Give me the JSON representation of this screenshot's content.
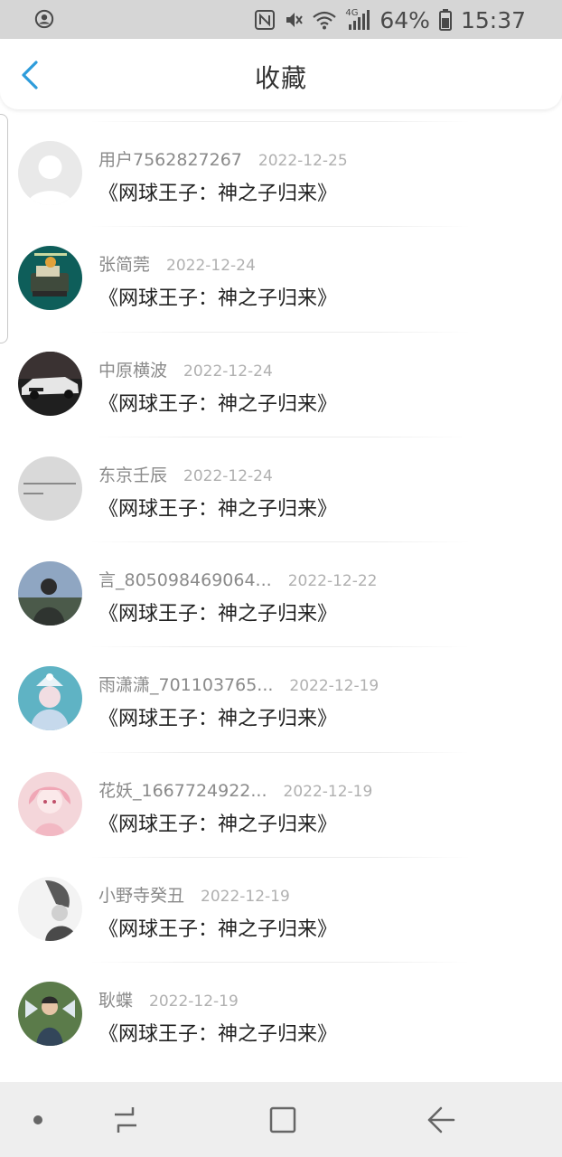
{
  "status_bar": {
    "battery": "64%",
    "time": "15:37",
    "network": "4G",
    "icons": [
      "account-circle-icon",
      "nfc-icon",
      "mute-icon",
      "wifi-icon",
      "signal-icon",
      "battery-icon"
    ]
  },
  "header": {
    "title": "收藏",
    "back_icon": "chevron-left-icon",
    "accent": "#2d9cdb"
  },
  "favorites": [
    {
      "name": "用户7562827267",
      "date": "2022-12-25",
      "work": "《网球王子：神之子归来》",
      "avatar": "default-gray"
    },
    {
      "name": "张简莞",
      "date": "2022-12-24",
      "work": "《网球王子：神之子归来》",
      "avatar": "teal-cartoon"
    },
    {
      "name": "中原横波",
      "date": "2022-12-24",
      "work": "《网球王子：神之子归来》",
      "avatar": "white-car"
    },
    {
      "name": "东京壬辰",
      "date": "2022-12-24",
      "work": "《网球王子：神之子归来》",
      "avatar": "gray-text"
    },
    {
      "name": "言_805098469064...",
      "date": "2022-12-22",
      "work": "《网球王子：神之子归来》",
      "avatar": "person-sky"
    },
    {
      "name": "雨潇潇_701103765...",
      "date": "2022-12-19",
      "work": "《网球王子：神之子归来》",
      "avatar": "fantasy-girl"
    },
    {
      "name": "花妖_1667724922...",
      "date": "2022-12-19",
      "work": "《网球王子：神之子归来》",
      "avatar": "pink-anime"
    },
    {
      "name": "小野寺癸丑",
      "date": "2022-12-19",
      "work": "《网球王子：神之子归来》",
      "avatar": "bw-portrait"
    },
    {
      "name": "耿蝶",
      "date": "2022-12-19",
      "work": "《网球王子：神之子归来》",
      "avatar": "child-wings"
    }
  ],
  "nav_bar": {
    "icons": [
      "dot-icon",
      "recent-apps-icon",
      "home-icon",
      "back-arrow-icon"
    ]
  }
}
